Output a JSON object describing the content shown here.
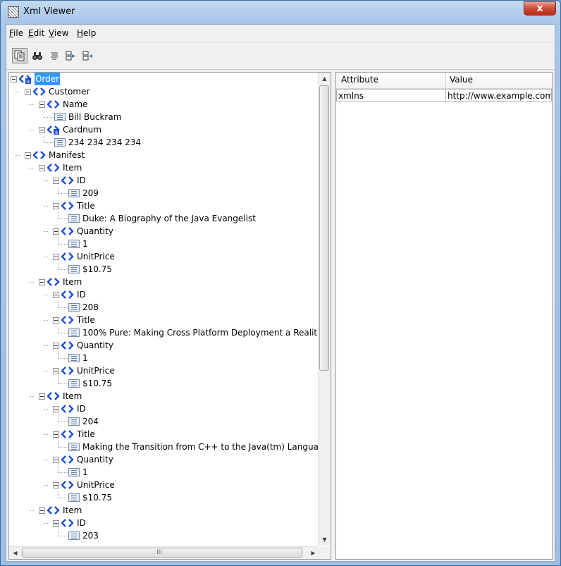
{
  "window": {
    "title": "Xml Viewer",
    "close_label": "x"
  },
  "menu": {
    "items": [
      {
        "label": "File",
        "mnemonic": "F",
        "rest": "ile"
      },
      {
        "label": "Edit",
        "mnemonic": "E",
        "rest": "dit"
      },
      {
        "label": "View",
        "mnemonic": "V",
        "rest": "iew"
      },
      {
        "label": "Help",
        "mnemonic": "H",
        "rest": "elp"
      }
    ]
  },
  "toolbar": {
    "buttons": [
      {
        "icon": "copy-icon",
        "pressed": true
      },
      {
        "icon": "binoculars-find-icon",
        "pressed": false
      },
      {
        "icon": "align-text-icon",
        "pressed": false
      },
      {
        "icon": "expand-all-icon",
        "pressed": false
      },
      {
        "icon": "collapse-all-icon",
        "pressed": false
      }
    ]
  },
  "tree": {
    "nodes": [
      {
        "text": "Order",
        "kind": "element-attr",
        "depth": 0,
        "selected": true
      },
      {
        "text": "Customer",
        "kind": "element",
        "depth": 1
      },
      {
        "text": "Name",
        "kind": "element",
        "depth": 2
      },
      {
        "text": "Bill Buckram",
        "kind": "text",
        "depth": 3
      },
      {
        "text": "Cardnum",
        "kind": "element-attr",
        "depth": 2
      },
      {
        "text": "234 234 234 234",
        "kind": "text",
        "depth": 3
      },
      {
        "text": "Manifest",
        "kind": "element",
        "depth": 1
      },
      {
        "text": "Item",
        "kind": "element",
        "depth": 2
      },
      {
        "text": "ID",
        "kind": "element",
        "depth": 3
      },
      {
        "text": "209",
        "kind": "text",
        "depth": 4
      },
      {
        "text": "Title",
        "kind": "element",
        "depth": 3
      },
      {
        "text": "Duke: A Biography of the Java Evangelist",
        "kind": "text",
        "depth": 4
      },
      {
        "text": "Quantity",
        "kind": "element",
        "depth": 3
      },
      {
        "text": "1",
        "kind": "text",
        "depth": 4
      },
      {
        "text": "UnitPrice",
        "kind": "element",
        "depth": 3
      },
      {
        "text": "$10.75",
        "kind": "text",
        "depth": 4
      },
      {
        "text": "Item",
        "kind": "element",
        "depth": 2
      },
      {
        "text": "ID",
        "kind": "element",
        "depth": 3
      },
      {
        "text": "208",
        "kind": "text",
        "depth": 4
      },
      {
        "text": "Title",
        "kind": "element",
        "depth": 3
      },
      {
        "text": "100% Pure: Making Cross Platform Deployment a Realit",
        "kind": "text",
        "depth": 4
      },
      {
        "text": "Quantity",
        "kind": "element",
        "depth": 3
      },
      {
        "text": "1",
        "kind": "text",
        "depth": 4
      },
      {
        "text": "UnitPrice",
        "kind": "element",
        "depth": 3
      },
      {
        "text": "$10.75",
        "kind": "text",
        "depth": 4
      },
      {
        "text": "Item",
        "kind": "element",
        "depth": 2
      },
      {
        "text": "ID",
        "kind": "element",
        "depth": 3
      },
      {
        "text": "204",
        "kind": "text",
        "depth": 4
      },
      {
        "text": "Title",
        "kind": "element",
        "depth": 3
      },
      {
        "text": "Making the Transition from C++ to the Java(tm) Langua",
        "kind": "text",
        "depth": 4
      },
      {
        "text": "Quantity",
        "kind": "element",
        "depth": 3
      },
      {
        "text": "1",
        "kind": "text",
        "depth": 4
      },
      {
        "text": "UnitPrice",
        "kind": "element",
        "depth": 3
      },
      {
        "text": "$10.75",
        "kind": "text",
        "depth": 4
      },
      {
        "text": "Item",
        "kind": "element",
        "depth": 2
      },
      {
        "text": "ID",
        "kind": "element",
        "depth": 3
      },
      {
        "text": "203",
        "kind": "text",
        "depth": 4
      }
    ],
    "hscroll_grip": "III"
  },
  "attributes": {
    "columns": [
      "Attribute",
      "Value"
    ],
    "rows": [
      {
        "attribute": "xmlns",
        "value": "http://www.example.com..."
      }
    ]
  },
  "colors": {
    "selection": "#3399ff",
    "element_icon": "#1e4fd6",
    "titlebar": "#b9d1ea",
    "close_button": "#c9452e"
  }
}
